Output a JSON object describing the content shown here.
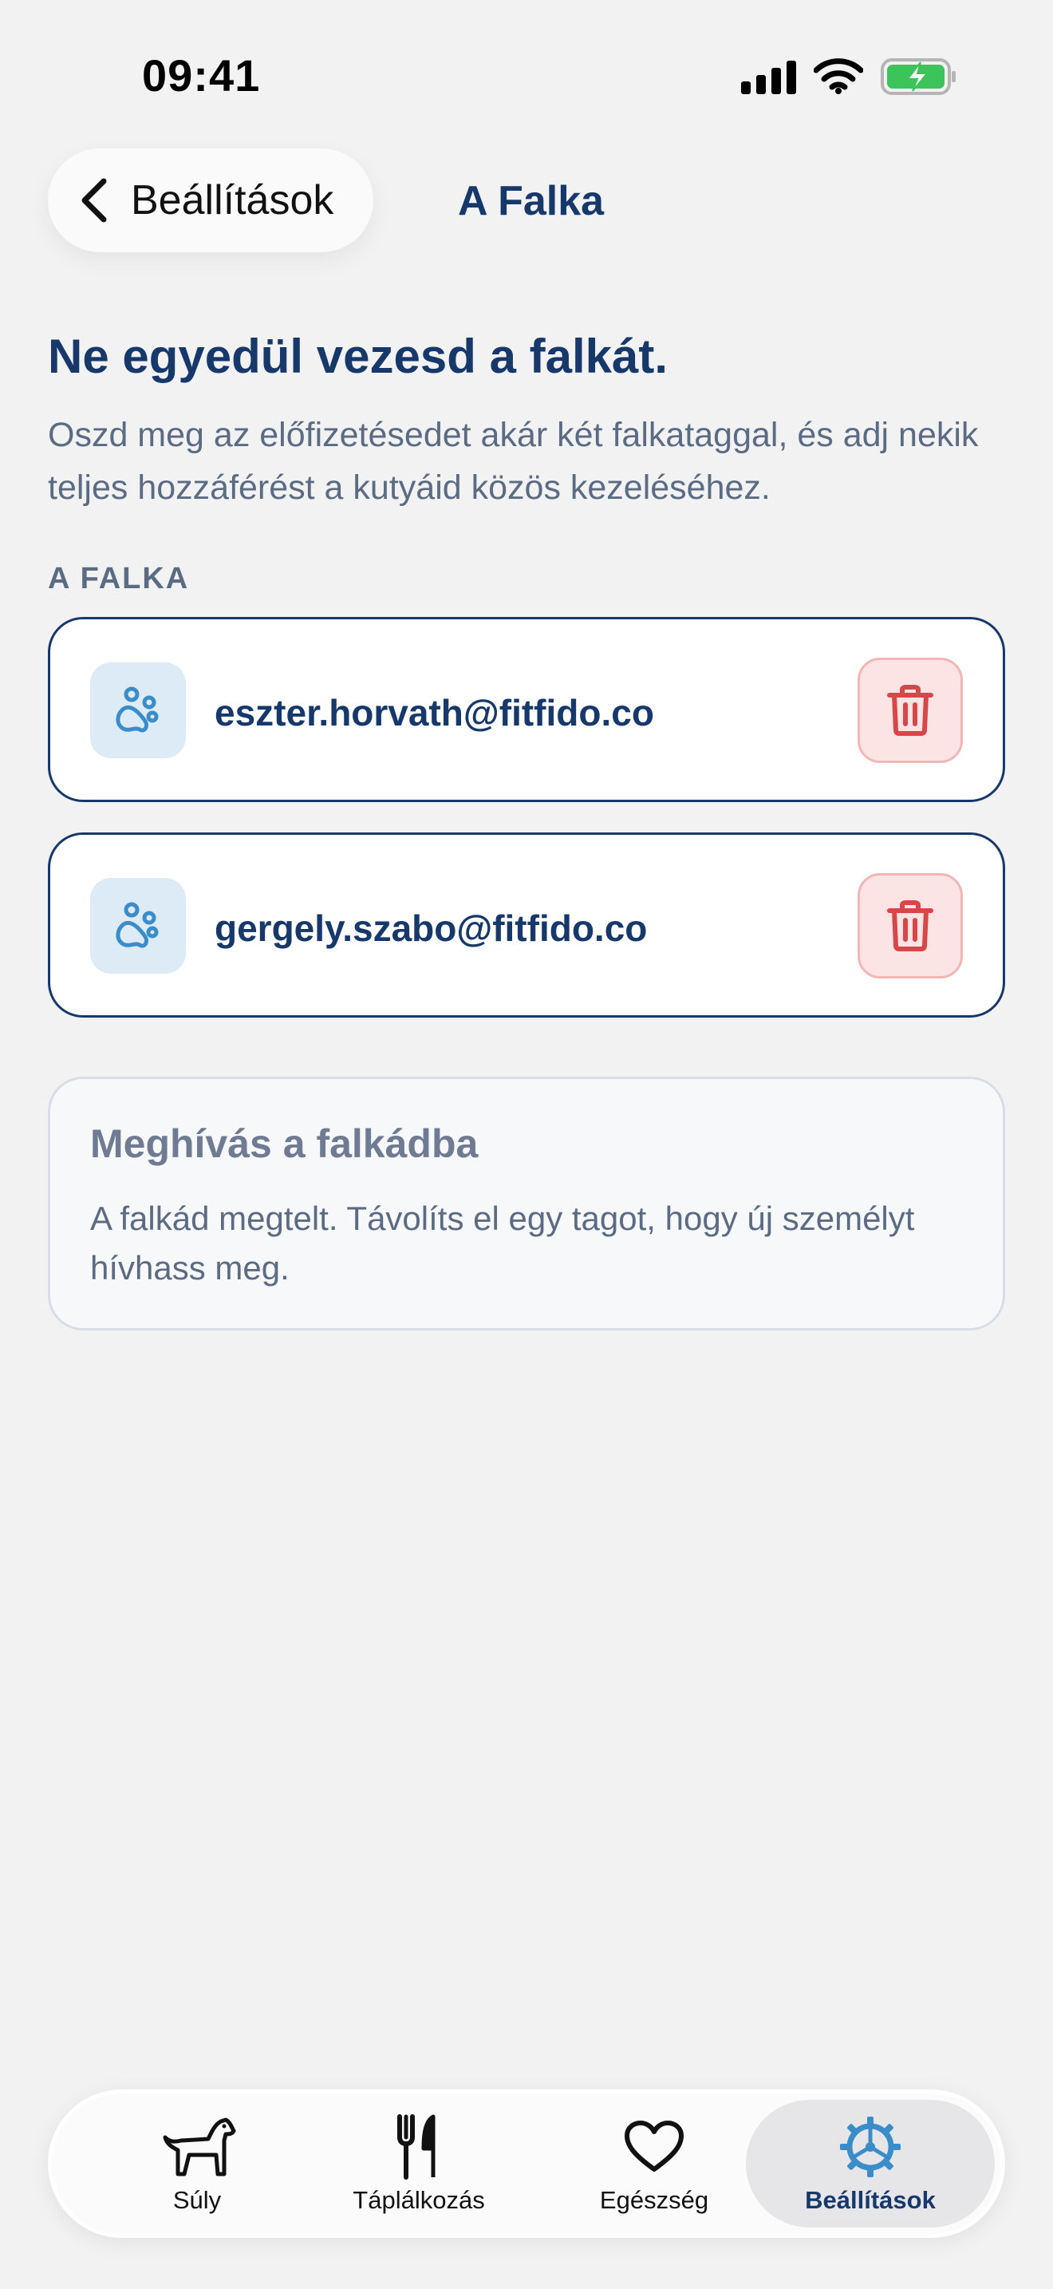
{
  "status": {
    "time": "09:41"
  },
  "nav": {
    "back_label": "Beállítások",
    "title": "A Falka"
  },
  "content": {
    "heading": "Ne egyedül vezesd a falkát.",
    "description": "Oszd meg az előfizetésedet akár két falkataggal, és adj nekik teljes hozzáférést a kutyáid közös kezeléséhez.",
    "section_label": "A FALKA",
    "members": [
      {
        "email": "eszter.horvath@fitfido.co"
      },
      {
        "email": "gergely.szabo@fitfido.co"
      }
    ],
    "invite": {
      "title": "Meghívás a falkádba",
      "text": "A falkád megtelt. Távolíts el egy tagot, hogy új személyt hívhass meg."
    }
  },
  "tabbar": {
    "tabs": [
      {
        "label": "Súly",
        "icon": "dog-icon"
      },
      {
        "label": "Táplálkozás",
        "icon": "fork-knife-icon"
      },
      {
        "label": "Egészség",
        "icon": "heart-icon"
      },
      {
        "label": "Beállítások",
        "icon": "gear-icon",
        "active": true
      }
    ]
  },
  "colors": {
    "primary": "#17386b",
    "accent_blue": "#3b8dc9",
    "danger": "#d9464a",
    "background": "#f2f2f3"
  }
}
